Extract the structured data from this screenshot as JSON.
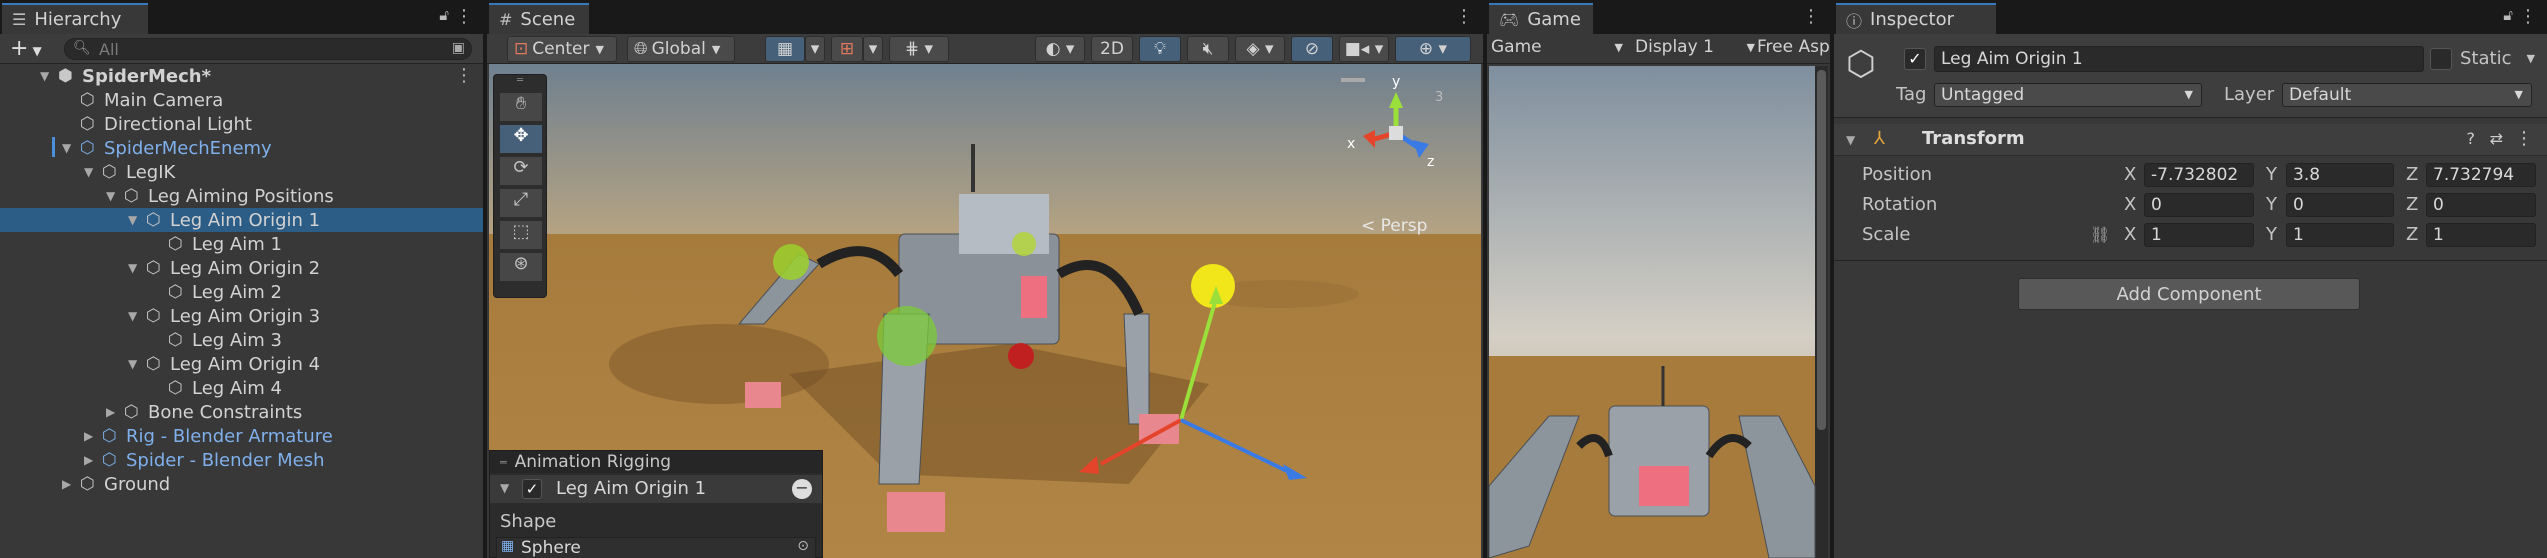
{
  "hierarchy": {
    "tab_label": "Hierarchy",
    "add_label": "+",
    "search_placeholder": "All",
    "items": [
      {
        "label": "SpiderMech*",
        "depth": 0,
        "expanded": true,
        "bold": true,
        "prefab": false
      },
      {
        "label": "Main Camera",
        "depth": 1,
        "expanded": null,
        "bold": false,
        "prefab": false
      },
      {
        "label": "Directional Light",
        "depth": 1,
        "expanded": null,
        "bold": false,
        "prefab": false
      },
      {
        "label": "SpiderMechEnemy",
        "depth": 1,
        "expanded": true,
        "bold": false,
        "prefab": true
      },
      {
        "label": "LegIK",
        "depth": 2,
        "expanded": true,
        "bold": false,
        "prefab": false
      },
      {
        "label": "Leg Aiming Positions",
        "depth": 3,
        "expanded": true,
        "bold": false,
        "prefab": false
      },
      {
        "label": "Leg Aim Origin 1",
        "depth": 4,
        "expanded": true,
        "bold": false,
        "prefab": false,
        "selected": true
      },
      {
        "label": "Leg Aim 1",
        "depth": 5,
        "expanded": null,
        "bold": false,
        "prefab": false
      },
      {
        "label": "Leg Aim Origin 2",
        "depth": 4,
        "expanded": true,
        "bold": false,
        "prefab": false
      },
      {
        "label": "Leg Aim 2",
        "depth": 5,
        "expanded": null,
        "bold": false,
        "prefab": false
      },
      {
        "label": "Leg Aim Origin 3",
        "depth": 4,
        "expanded": true,
        "bold": false,
        "prefab": false
      },
      {
        "label": "Leg Aim 3",
        "depth": 5,
        "expanded": null,
        "bold": false,
        "prefab": false
      },
      {
        "label": "Leg Aim Origin 4",
        "depth": 4,
        "expanded": true,
        "bold": false,
        "prefab": false
      },
      {
        "label": "Leg Aim 4",
        "depth": 5,
        "expanded": null,
        "bold": false,
        "prefab": false
      },
      {
        "label": "Bone Constraints",
        "depth": 3,
        "expanded": false,
        "bold": false,
        "prefab": false
      },
      {
        "label": "Rig - Blender Armature",
        "depth": 2,
        "expanded": false,
        "bold": false,
        "prefab": true
      },
      {
        "label": "Spider - Blender Mesh",
        "depth": 2,
        "expanded": false,
        "bold": false,
        "prefab": true
      },
      {
        "label": "Ground",
        "depth": 1,
        "expanded": false,
        "bold": false,
        "prefab": false
      }
    ]
  },
  "scene": {
    "tab_label": "Scene",
    "pivot_label": "Center",
    "space_label": "Global",
    "mode_2d_label": "2D",
    "persp_label": "< Persp",
    "gizmo_axes": {
      "x": "x",
      "y": "y",
      "z": "z"
    },
    "overlay": {
      "title": "Animation Rigging",
      "item_label": "Leg Aim Origin 1",
      "shape_label": "Shape",
      "shape_value": "Sphere"
    }
  },
  "game": {
    "tab_label": "Game",
    "view_select": "Game",
    "display_select": "Display 1",
    "aspect_select": "Free Asp"
  },
  "inspector": {
    "tab_label": "Inspector",
    "object_name": "Leg Aim Origin 1",
    "static_label": "Static",
    "tag_label": "Tag",
    "tag_value": "Untagged",
    "layer_label": "Layer",
    "layer_value": "Default",
    "component_title": "Transform",
    "position_label": "Position",
    "rotation_label": "Rotation",
    "scale_label": "Scale",
    "axis_x": "X",
    "axis_y": "Y",
    "axis_z": "Z",
    "position": {
      "x": "-7.732802",
      "y": "3.8",
      "z": "7.732794"
    },
    "rotation": {
      "x": "0",
      "y": "0",
      "z": "0"
    },
    "scale": {
      "x": "1",
      "y": "1",
      "z": "1"
    },
    "add_component_label": "Add Component"
  },
  "colors": {
    "accent": "#3a79bb",
    "selection": "#2c5d87",
    "prefab_text": "#7fb0ec",
    "ground": "#a77d3f",
    "sky": "#8fa0b0"
  }
}
